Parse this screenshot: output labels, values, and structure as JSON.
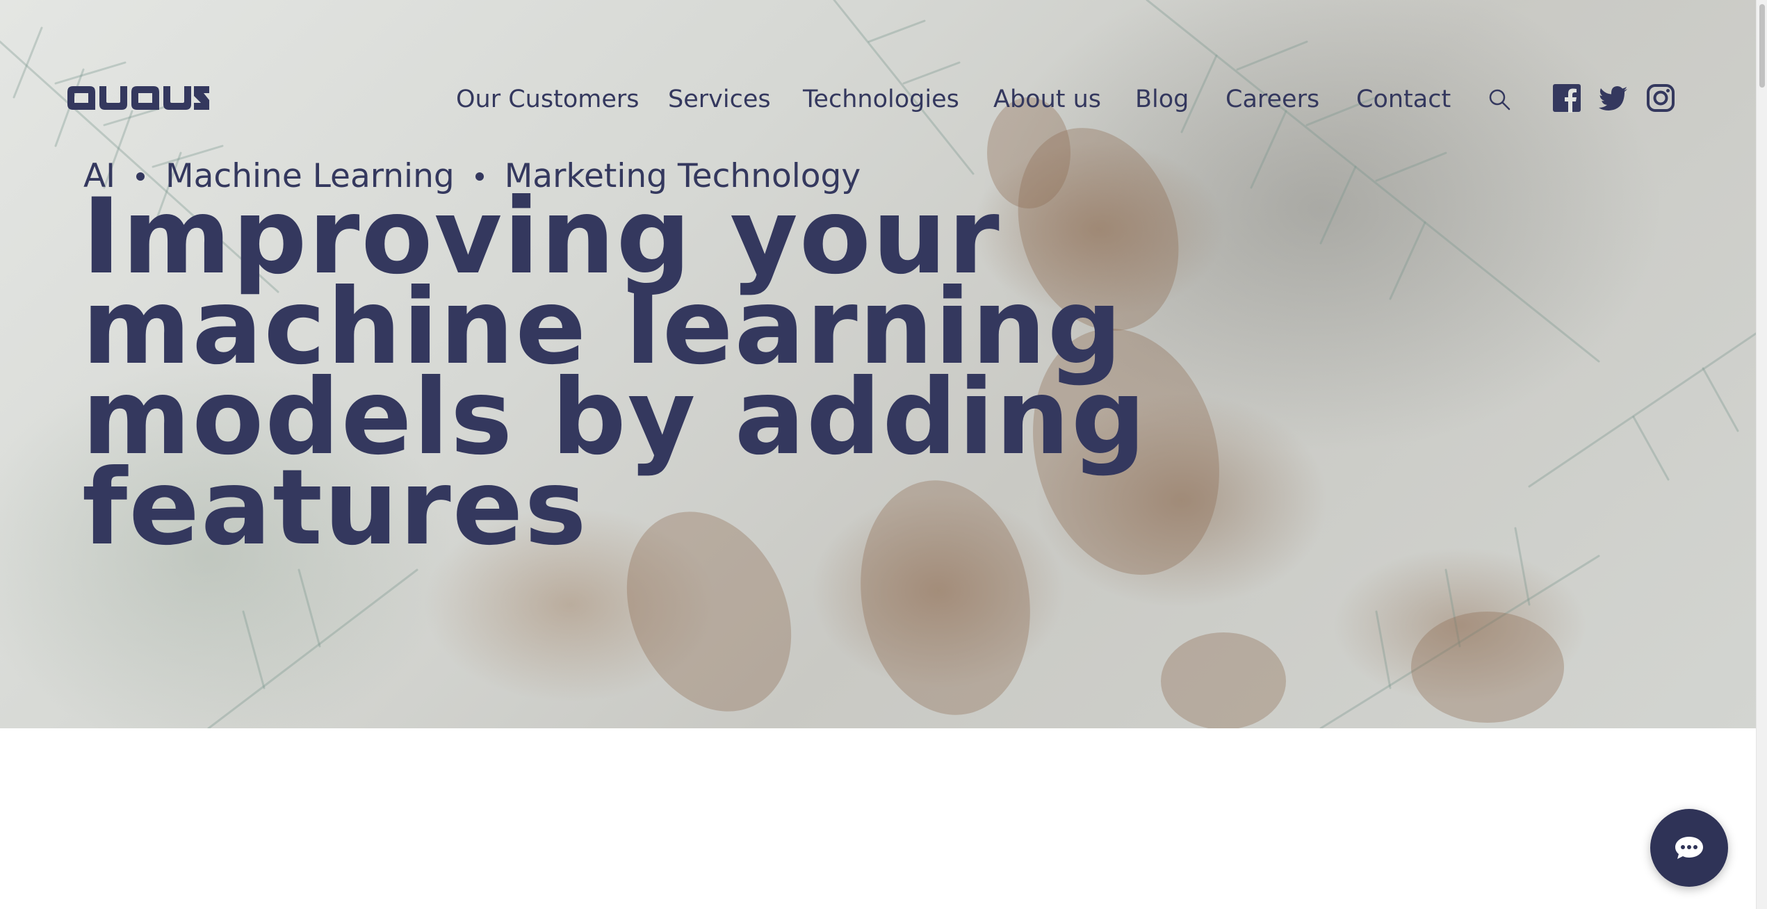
{
  "header": {
    "logo_text": "avaus",
    "nav_items": [
      "Our Customers",
      "Services",
      "Technologies",
      "About us",
      "Blog",
      "Careers",
      "Contact"
    ]
  },
  "icons": {
    "search": "search-icon",
    "facebook": "facebook-icon",
    "twitter": "twitter-icon",
    "instagram": "instagram-icon",
    "chat": "chat-icon"
  },
  "hero": {
    "tags": [
      "AI",
      "Machine Learning",
      "Marketing Technology"
    ],
    "title_lines": [
      "Improving your",
      "machine learning",
      "models by adding",
      "features"
    ]
  },
  "colors": {
    "primary_text": "#34385e",
    "chat_button": "#2f3357"
  }
}
